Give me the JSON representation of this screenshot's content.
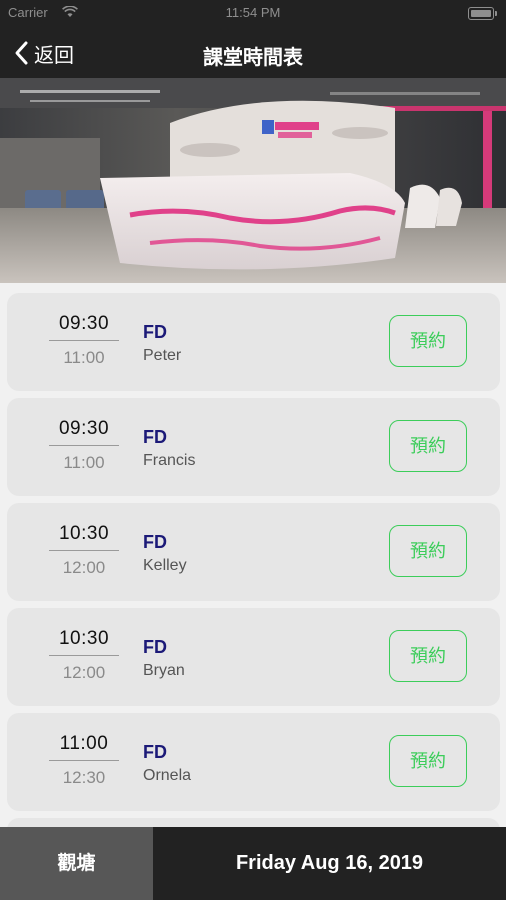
{
  "status_bar": {
    "carrier": "Carrier",
    "time": "11:54 PM"
  },
  "nav": {
    "back_label": "返回",
    "title": "課堂時間表"
  },
  "hero": {
    "alt": "Studio reception"
  },
  "classes": [
    {
      "start": "09:30",
      "end": "11:00",
      "name": "FD",
      "teacher": "Peter",
      "action": "預約"
    },
    {
      "start": "09:30",
      "end": "11:00",
      "name": "FD",
      "teacher": "Francis",
      "action": "預約"
    },
    {
      "start": "10:30",
      "end": "12:00",
      "name": "FD",
      "teacher": "Kelley",
      "action": "預約"
    },
    {
      "start": "10:30",
      "end": "12:00",
      "name": "FD",
      "teacher": "Bryan",
      "action": "預約"
    },
    {
      "start": "11:00",
      "end": "12:30",
      "name": "FD",
      "teacher": "Ornela",
      "action": "預約"
    }
  ],
  "bottom": {
    "browse_label": "觀塘",
    "date_label": "Friday Aug 16, 2019"
  },
  "colors": {
    "accent_green": "#3ccd5a",
    "class_name": "#1c1a78",
    "bar_dark": "#222222"
  }
}
